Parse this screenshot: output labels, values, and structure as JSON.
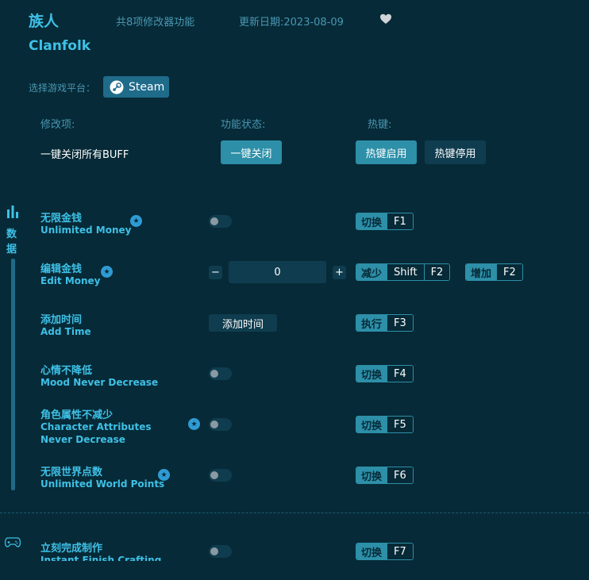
{
  "header": {
    "title_cn": "族人",
    "title_en": "Clanfolk",
    "feature_count": "共8项修改器功能",
    "update_date": "更新日期:2023-08-09"
  },
  "platform": {
    "label": "选择游戏平台：",
    "steam": "Steam"
  },
  "columns": {
    "item": "修改项:",
    "status": "功能状态:",
    "hotkey": "热键:"
  },
  "global": {
    "label": "一键关闭所有BUFF",
    "close_all": "一键关闭",
    "hotkey_enable": "热键启用",
    "hotkey_disable": "热键停用"
  },
  "sidebar": {
    "data_label": "数据"
  },
  "rows": [
    {
      "cn": "无限金钱",
      "en": "Unlimited Money",
      "act": "切换",
      "key": "F1"
    },
    {
      "cn": "编辑金钱",
      "en": "Edit Money",
      "value": "0",
      "dec_act": "减少",
      "dec_mod": "Shift",
      "dec_key": "F2",
      "inc_act": "增加",
      "inc_key": "F2"
    },
    {
      "cn": "添加时间",
      "en": "Add Time",
      "button": "添加时间",
      "act": "执行",
      "key": "F3"
    },
    {
      "cn": "心情不降低",
      "en": "Mood Never Decrease",
      "act": "切换",
      "key": "F4"
    },
    {
      "cn": "角色属性不减少",
      "en": "Character Attributes Never Decrease",
      "act": "切换",
      "key": "F5"
    },
    {
      "cn": "无限世界点数",
      "en": "Unlimited World Points",
      "act": "切换",
      "key": "F6"
    },
    {
      "cn": "立刻完成制作",
      "en": "Instant Finish Crafting",
      "act": "切换",
      "key": "F7"
    }
  ],
  "stepper": {
    "minus": "−",
    "plus": "+"
  },
  "colors": {
    "background": "#062a37",
    "accent": "#3fc0e6",
    "button": "#2d8fa8",
    "dark": "#0f3d4f"
  }
}
